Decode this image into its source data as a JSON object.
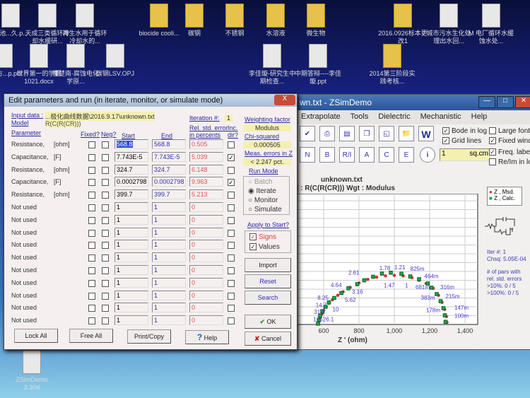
{
  "desktop": {
    "icons": [
      "建池...久.p...",
      "天成三类循环冷却水缓研...",
      "再生水用于循环冷却水的...",
      "biocide cooli...",
      "碳钢",
      "不锈钢",
      "水溶液",
      "微生物",
      "2016.0926标本更改1",
      "城市污水生化处理出水回...",
      "M 电厂循环水缓蚀水处...",
      "...量方...p.pdf",
      "世界第一的学霸1021.docx",
      "曹楚南-腐蚀电化学原...",
      "碳钢LSV.OPJ",
      "李佳璇-研究生中期检查...",
      "中期答辩----李佳璇.ppt",
      "2014第三阶段实践考核...",
      "ZSimDemo 3.30d"
    ]
  },
  "zsim": {
    "title": "wn.txt - ZSimDemo",
    "menu": [
      "Extrapolate",
      "Tools",
      "Dielectric",
      "Mechanistic",
      "Help"
    ],
    "toolbar_buttons": [
      "N",
      "B",
      "R/I",
      "A",
      "C",
      "E"
    ],
    "options": [
      {
        "label": "Bode in log",
        "checked": true
      },
      {
        "label": "Grid lines",
        "checked": true
      },
      {
        "label": "Large fonts",
        "checked": false
      },
      {
        "label": "Fixed window",
        "checked": true
      },
      {
        "label": "Freq. labels",
        "checked": true
      },
      {
        "label": "Re/Im in log",
        "checked": false
      }
    ],
    "area_value": "1",
    "area_unit": "sq.cm",
    "stats": {
      "iter": "Iter #:   1",
      "chsq": "Chsq:   5.05E-04",
      "pars_title": "# of pars with",
      "pars_sub": "rel. std. errors",
      "gt10": ">10%:     0 / 5",
      "gt100": ">100%:   0 / 5"
    }
  },
  "chart_data": {
    "type": "scatter",
    "title": "unknown.txt",
    "subtitle": "el : R(C(R(CR)))     Wgt : Modulus",
    "xlabel": "Z ' (ohm)",
    "xticks": [
      600,
      800,
      1000,
      1200,
      1400
    ],
    "xtick_labels": [
      "600",
      "800",
      "1,000",
      "1,200",
      "1,400"
    ],
    "xlim": [
      440,
      1440
    ],
    "ylim": [
      0,
      740
    ],
    "grid": true,
    "legend": [
      "Z , Msd.",
      "Z , Calc."
    ],
    "legend_position": "top-right",
    "series": [
      {
        "name": "Z , Msd.",
        "color": "#d83030",
        "points": [
          [
            570,
            5
          ],
          [
            575,
            20
          ],
          [
            580,
            40
          ],
          [
            590,
            60
          ],
          [
            600,
            80
          ],
          [
            615,
            100
          ],
          [
            630,
            120
          ],
          [
            650,
            140
          ],
          [
            680,
            165
          ],
          [
            710,
            185
          ],
          [
            750,
            210
          ],
          [
            800,
            235
          ],
          [
            850,
            255
          ],
          [
            900,
            268
          ],
          [
            950,
            275
          ],
          [
            1000,
            278
          ],
          [
            1050,
            275
          ],
          [
            1100,
            265
          ],
          [
            1140,
            250
          ],
          [
            1180,
            232
          ],
          [
            1220,
            205
          ],
          [
            1250,
            165
          ],
          [
            1270,
            125
          ],
          [
            1285,
            85
          ],
          [
            1295,
            45
          ],
          [
            1298,
            12
          ]
        ]
      },
      {
        "name": "Z , Calc.",
        "color": "#30a040",
        "points": [
          [
            568,
            5
          ],
          [
            573,
            25
          ],
          [
            580,
            50
          ],
          [
            592,
            75
          ],
          [
            610,
            100
          ],
          [
            630,
            125
          ],
          [
            660,
            150
          ],
          [
            700,
            178
          ],
          [
            740,
            205
          ],
          [
            790,
            228
          ],
          [
            830,
            250
          ],
          [
            880,
            270
          ],
          [
            930,
            288
          ],
          [
            980,
            293
          ],
          [
            1040,
            287
          ],
          [
            1090,
            272
          ],
          [
            1140,
            256
          ],
          [
            1190,
            232
          ],
          [
            1210,
            208
          ],
          [
            1240,
            172
          ],
          [
            1262,
            132
          ],
          [
            1278,
            92
          ],
          [
            1286,
            52
          ],
          [
            1290,
            15
          ]
        ]
      }
    ],
    "freq_labels": [
      [
        "176",
        540,
        18
      ],
      [
        "31.6",
        545,
        60
      ],
      [
        "14.7",
        555,
        98
      ],
      [
        "8.25",
        565,
        140
      ],
      [
        "4.64",
        640,
        212
      ],
      [
        "2.61",
        740,
        282
      ],
      [
        "1.78",
        915,
        308
      ],
      [
        "1.21",
        1000,
        312
      ],
      [
        "825m",
        1090,
        305
      ],
      [
        "26.1",
        595,
        18
      ],
      [
        "10",
        650,
        75
      ],
      [
        "5.62",
        720,
        128
      ],
      [
        "3.16",
        760,
        175
      ],
      [
        "1.47",
        940,
        210
      ],
      [
        "1",
        1060,
        210
      ],
      [
        "681m",
        1120,
        200
      ],
      [
        "464m",
        1170,
        262
      ],
      [
        "316m",
        1260,
        200
      ],
      [
        "383m",
        1150,
        140
      ],
      [
        "215m",
        1290,
        148
      ],
      [
        "178m",
        1180,
        70
      ],
      [
        "147m",
        1340,
        85
      ],
      [
        "100m",
        1340,
        38
      ]
    ]
  },
  "dialog": {
    "title": "Edit parameters and run (in iterate, monitor, or simulate mode)",
    "close": "X",
    "input_label": "Input data :",
    "input_value": "...极化曲线数据\\2016.9.17\\unknown.txt",
    "model_label": "Model",
    "model_value": "R(C(R(CR)))",
    "iteration_label": "Iteration #:",
    "iteration_value": "1",
    "headers": {
      "parameter": "Parameter",
      "fixed": "Fixed?",
      "neg": "Neg?",
      "start": "Start",
      "end": "End",
      "relerr": "Rel. std. error in percents",
      "inc": "Inc. dir?"
    },
    "rows": [
      {
        "name": "Resistance,",
        "unit": "[ohm]",
        "start": "568.8",
        "end": "568.8",
        "err": "0.505",
        "inc": false
      },
      {
        "name": "Capacitance,",
        "unit": "[F]",
        "start": "7.743E-5",
        "end": "7.743E-5",
        "err": "5.039",
        "inc": true
      },
      {
        "name": "Resistance,",
        "unit": "[ohm]",
        "start": "324.7",
        "end": "324.7",
        "err": "6.148",
        "inc": false
      },
      {
        "name": "Capacitance,",
        "unit": "[F]",
        "start": "0.0002798",
        "end": "0.0002798",
        "err": "9.963",
        "inc": true
      },
      {
        "name": "Resistance,",
        "unit": "[ohm]",
        "start": "399.7",
        "end": "399.7",
        "err": "5.213",
        "inc": false
      },
      {
        "name": "Not used",
        "unit": "",
        "start": "1",
        "end": "1",
        "err": "0",
        "inc": false
      },
      {
        "name": "Not used",
        "unit": "",
        "start": "1",
        "end": "1",
        "err": "0",
        "inc": false
      },
      {
        "name": "Not used",
        "unit": "",
        "start": "1",
        "end": "1",
        "err": "0",
        "inc": false
      },
      {
        "name": "Not used",
        "unit": "",
        "start": "1",
        "end": "1",
        "err": "0",
        "inc": false
      },
      {
        "name": "Not used",
        "unit": "",
        "start": "1",
        "end": "1",
        "err": "0",
        "inc": false
      },
      {
        "name": "Not used",
        "unit": "",
        "start": "1",
        "end": "1",
        "err": "0",
        "inc": false
      },
      {
        "name": "Not used",
        "unit": "",
        "start": "1",
        "end": "1",
        "err": "0",
        "inc": false
      },
      {
        "name": "Not used",
        "unit": "",
        "start": "1",
        "end": "1",
        "err": "0",
        "inc": false
      },
      {
        "name": "Not used",
        "unit": "",
        "start": "1",
        "end": "1",
        "err": "0",
        "inc": false
      },
      {
        "name": "Not used",
        "unit": "",
        "start": "1",
        "end": "1",
        "err": "0",
        "inc": false
      }
    ],
    "weighting_label": "Weighting factor",
    "weighting_value": "Modulus",
    "chisq_label": "Chi-squared",
    "chisq_value": "0.000505",
    "meas_label": "Meas. errors in Z",
    "meas_value": "< 2.247 pct.",
    "runmode_label": "Run Mode",
    "runmodes": [
      {
        "label": "Batch",
        "selected": false
      },
      {
        "label": "Iterate",
        "selected": true
      },
      {
        "label": "Monitor",
        "selected": false
      },
      {
        "label": "Simulate",
        "selected": false
      }
    ],
    "apply_label": "Apply to Start?",
    "apply": [
      {
        "label": "Signs",
        "checked": true
      },
      {
        "label": "Values",
        "checked": true
      }
    ],
    "buttons": {
      "import": "Import",
      "reset": "Reset",
      "search": "Search",
      "ok": "OK",
      "cancel": "Cancel",
      "lock": "Lock All",
      "free": "Free All",
      "print": "Print/Copy",
      "help": "Help"
    }
  }
}
